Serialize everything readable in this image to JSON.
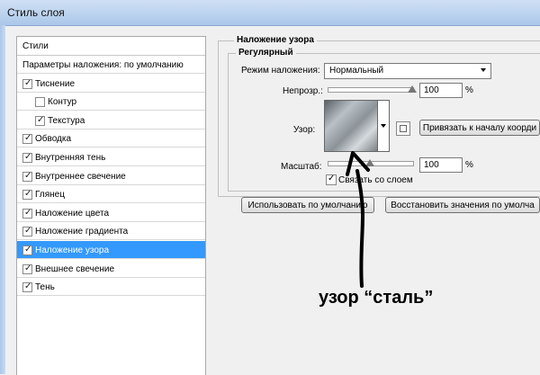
{
  "window": {
    "title": "Стиль слоя"
  },
  "sidebar": {
    "header": "Стили",
    "items": [
      {
        "label": "Параметры наложения: по умолчанию",
        "checkbox": false,
        "checked": false,
        "indent": 0,
        "selected": false
      },
      {
        "label": "Тиснение",
        "checkbox": true,
        "checked": true,
        "indent": 0,
        "selected": false
      },
      {
        "label": "Контур",
        "checkbox": true,
        "checked": false,
        "indent": 1,
        "selected": false
      },
      {
        "label": "Текстура",
        "checkbox": true,
        "checked": true,
        "indent": 1,
        "selected": false
      },
      {
        "label": "Обводка",
        "checkbox": true,
        "checked": true,
        "indent": 0,
        "selected": false
      },
      {
        "label": "Внутренняя тень",
        "checkbox": true,
        "checked": true,
        "indent": 0,
        "selected": false
      },
      {
        "label": "Внутреннее свечение",
        "checkbox": true,
        "checked": true,
        "indent": 0,
        "selected": false
      },
      {
        "label": "Глянец",
        "checkbox": true,
        "checked": true,
        "indent": 0,
        "selected": false
      },
      {
        "label": "Наложение цвета",
        "checkbox": true,
        "checked": true,
        "indent": 0,
        "selected": false
      },
      {
        "label": "Наложение градиента",
        "checkbox": true,
        "checked": true,
        "indent": 0,
        "selected": false
      },
      {
        "label": "Наложение узора",
        "checkbox": true,
        "checked": true,
        "indent": 0,
        "selected": true
      },
      {
        "label": "Внешнее свечение",
        "checkbox": true,
        "checked": true,
        "indent": 0,
        "selected": false
      },
      {
        "label": "Тень",
        "checkbox": true,
        "checked": true,
        "indent": 0,
        "selected": false
      }
    ]
  },
  "panel": {
    "group_title": "Наложение узора",
    "subgroup_title": "Регулярный",
    "blend_mode_label": "Режим наложения:",
    "blend_mode_value": "Нормальный",
    "opacity_label": "Непрозр.:",
    "opacity_value": "100",
    "opacity_unit": "%",
    "opacity_level": 1.0,
    "pattern_label": "Узор:",
    "snap_button": "Привязать к началу коорди",
    "scale_label": "Масштаб:",
    "scale_value": "100",
    "scale_unit": "%",
    "scale_level": 0.5,
    "link_label": "Связать со слоем",
    "link_checked": true,
    "default_button": "Использовать по умолчанию",
    "reset_button": "Восстановить значения по умолча"
  },
  "annotation": {
    "text": "узор “сталь”"
  },
  "icons": {
    "checkmark": "checkmark-icon",
    "dropdown": "chevron-down-icon",
    "new_preset": "new-preset-icon"
  }
}
